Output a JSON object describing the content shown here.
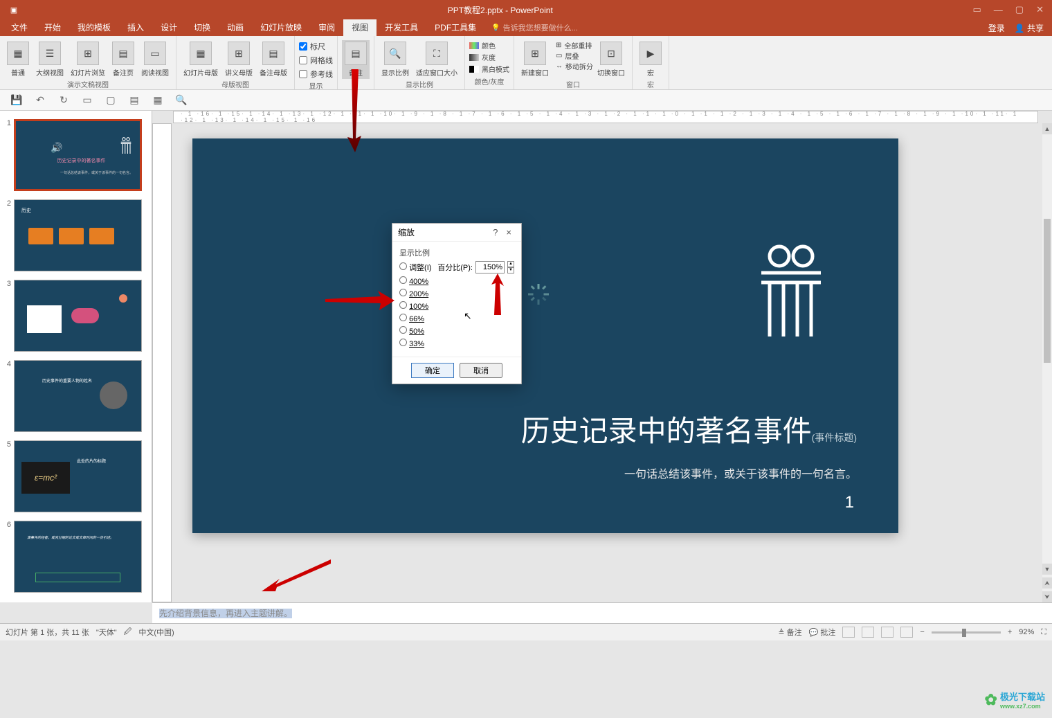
{
  "window": {
    "title": "PPT教程2.pptx - PowerPoint",
    "login": "登录",
    "share": "共享"
  },
  "tabs": {
    "file": "文件",
    "home": "开始",
    "templates": "我的模板",
    "insert": "插入",
    "design": "设计",
    "transitions": "切换",
    "animations": "动画",
    "slideshow": "幻灯片放映",
    "review": "审阅",
    "view": "视图",
    "developer": "开发工具",
    "pdf": "PDF工具集",
    "tellme": "告诉我您想要做什么..."
  },
  "ribbon": {
    "group_presentation_views": "演示文稿视图",
    "normal": "普通",
    "outline": "大纲视图",
    "sorter": "幻灯片浏览",
    "notes_page": "备注页",
    "reading": "阅读视图",
    "group_master_views": "母版视图",
    "slide_master": "幻灯片母版",
    "handout_master": "讲义母版",
    "notes_master": "备注母版",
    "group_show": "显示",
    "ruler": "标尺",
    "gridlines": "网格线",
    "guides": "参考线",
    "notes": "备注",
    "group_zoom": "显示比例",
    "zoom": "显示比例",
    "fit_window": "适应窗口大小",
    "group_colorgrey": "颜色/灰度",
    "color": "颜色",
    "greyscale": "灰度",
    "bw": "黑白模式",
    "group_window": "窗口",
    "new_window": "新建窗口",
    "arrange_all": "全部重排",
    "cascade": "层叠",
    "move_split": "移动拆分",
    "switch_windows": "切换窗口",
    "group_macros": "宏",
    "macros": "宏"
  },
  "dialog": {
    "title": "缩放",
    "help": "?",
    "close": "×",
    "group_label": "显示比例",
    "fit": "调整(I)",
    "percent_label": "百分比(P):",
    "percent_value": "150%",
    "opt_400": "400%",
    "opt_200": "200%",
    "opt_100": "100%",
    "opt_66": "66%",
    "opt_50": "50%",
    "opt_33": "33%",
    "ok": "确定",
    "cancel": "取消"
  },
  "slide": {
    "title": "历史记录中的著名事件",
    "subtitle": "(事件标题)",
    "quote": "一句话总结该事件，或关于该事件的一句名言。",
    "page": "1"
  },
  "notes": {
    "text": "先介绍背景信息，再进入主题讲解。"
  },
  "status": {
    "slide_info": "幻灯片 第 1 张，共 11 张",
    "theme": "\"天体\"",
    "lang": "中文(中国)",
    "notes_btn": "备注",
    "comments_btn": "批注",
    "zoom": "92%"
  },
  "thumbs": {
    "t1_title": "历史记录中的著名事件",
    "t2_label": "历史",
    "t4_label": "历史事件的重要人物的姓名",
    "t5_label": "此处的片的标题"
  },
  "watermark": {
    "name": "极光下载站",
    "url": "www.xz7.com"
  },
  "chart_data": null
}
